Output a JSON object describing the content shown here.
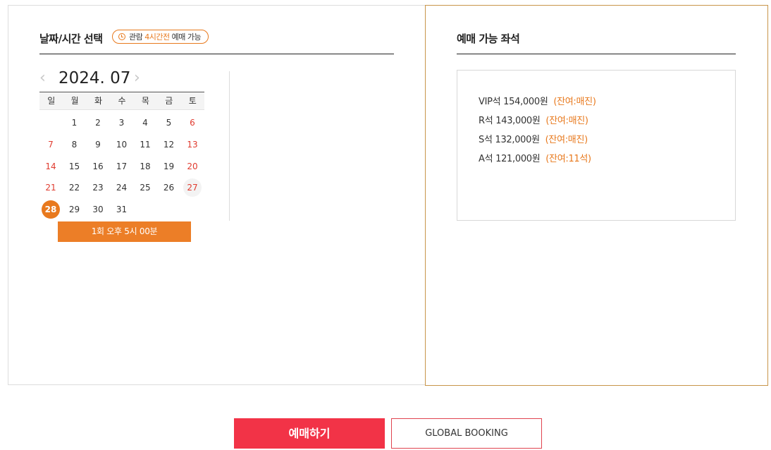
{
  "left": {
    "title": "날짜/시간 선택",
    "badge": {
      "prefix": "관람",
      "accent": "4시간전",
      "suffix": "예매 가능",
      "icon": "clock-icon"
    }
  },
  "calendar": {
    "prev_icon": "chevron-left-icon",
    "next_icon": "chevron-right-icon",
    "month": "2024. 07",
    "weekdays": [
      "일",
      "월",
      "화",
      "수",
      "목",
      "금",
      "토"
    ],
    "days": [
      "1",
      "2",
      "3",
      "4",
      "5",
      "6",
      "7",
      "8",
      "9",
      "10",
      "11",
      "12",
      "13",
      "14",
      "15",
      "16",
      "17",
      "18",
      "19",
      "20",
      "21",
      "22",
      "23",
      "24",
      "25",
      "26",
      "27",
      "28",
      "29",
      "30",
      "31"
    ],
    "available_days": [
      "27",
      "28"
    ],
    "selected_day": "28"
  },
  "time_slot": {
    "label": "1회  오후 5시 00분"
  },
  "right": {
    "title": "예매 가능 좌석",
    "seats": [
      {
        "grade": "VIP석",
        "price": "154,000원",
        "remain": "(잔여:매진)"
      },
      {
        "grade": "R석",
        "price": "143,000원",
        "remain": "(잔여:매진)"
      },
      {
        "grade": "S석",
        "price": "132,000원",
        "remain": "(잔여:매진)"
      },
      {
        "grade": "A석",
        "price": "121,000원",
        "remain": "(잔여:11석)"
      }
    ]
  },
  "buttons": {
    "book": "예매하기",
    "global": "GLOBAL BOOKING"
  },
  "colors": {
    "accent": "#e8791d",
    "book_button": "#f23347",
    "weekend": "#e03b2f"
  }
}
